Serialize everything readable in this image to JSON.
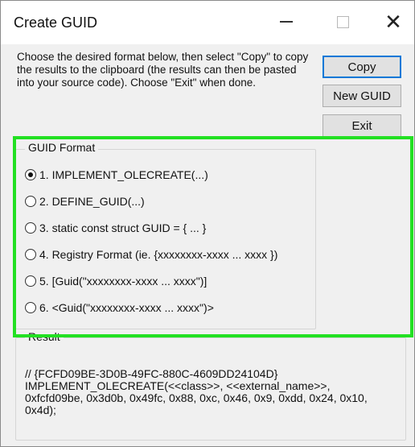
{
  "window": {
    "title": "Create GUID"
  },
  "description": "Choose the desired format below, then select \"Copy\" to copy the results to the clipboard (the results can then be pasted into your source code).  Choose \"Exit\" when done.",
  "buttons": {
    "copy": "Copy",
    "new_guid": "New GUID",
    "exit": "Exit"
  },
  "guid_format": {
    "label": "GUID Format",
    "options": [
      {
        "label": "1. IMPLEMENT_OLECREATE(...)",
        "selected": true
      },
      {
        "label": "2. DEFINE_GUID(...)",
        "selected": false
      },
      {
        "label": "3. static const struct GUID = { ... }",
        "selected": false
      },
      {
        "label": "4. Registry Format (ie. {xxxxxxxx-xxxx ... xxxx })",
        "selected": false
      },
      {
        "label": "5. [Guid(\"xxxxxxxx-xxxx ... xxxx\")]",
        "selected": false
      },
      {
        "label": "6. <Guid(\"xxxxxxxx-xxxx ... xxxx\")>",
        "selected": false
      }
    ]
  },
  "result": {
    "label": "Result",
    "text": "// {FCFD09BE-3D0B-49FC-880C-4609DD24104D}\nIMPLEMENT_OLECREATE(<<class>>, <<external_name>>,\n0xfcfd09be, 0x3d0b, 0x49fc, 0x88, 0xc, 0x46, 0x9, 0xdd, 0x24, 0x10,\n0x4d);"
  },
  "colors": {
    "highlight": "#22e022",
    "window_bg": "#f0f0f0",
    "button_focus": "#0078d7"
  }
}
